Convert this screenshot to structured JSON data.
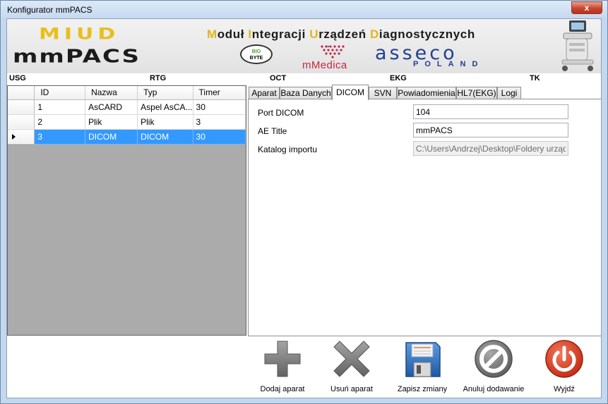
{
  "window": {
    "title": "Konfigurator mmPACS",
    "close_glyph": "x"
  },
  "banner": {
    "logo_top": "MIUD",
    "logo_bottom": "mmPACS",
    "headline": [
      {
        "t": "M",
        "hl": true
      },
      {
        "t": "oduł ",
        "hl": false
      },
      {
        "t": "I",
        "hl": true
      },
      {
        "t": "ntegracji ",
        "hl": false
      },
      {
        "t": "U",
        "hl": true
      },
      {
        "t": "rządzeń ",
        "hl": false
      },
      {
        "t": "D",
        "hl": true
      },
      {
        "t": "iagnostycznych",
        "hl": false
      }
    ],
    "biobyte_bio": "BIO",
    "biobyte_byte": "BYTE",
    "mmedica": "mMedica",
    "asseco": "asseco",
    "poland": "POLAND"
  },
  "modalities": [
    "USG",
    "RTG",
    "OCT",
    "EKG",
    "TK"
  ],
  "grid": {
    "columns": [
      "ID",
      "Nazwa",
      "Typ",
      "Timer"
    ],
    "rows": [
      {
        "id": "1",
        "nazwa": "AsCARD",
        "typ": "Aspel AsCA...",
        "timer": "30",
        "selected": false
      },
      {
        "id": "2",
        "nazwa": "Plik",
        "typ": "Plik",
        "timer": "3",
        "selected": false
      },
      {
        "id": "3",
        "nazwa": "DICOM",
        "typ": "DICOM",
        "timer": "30",
        "selected": true
      }
    ]
  },
  "tabs": [
    "Aparat",
    "Baza Danych",
    "DICOM",
    "SVN",
    "Powiadomienia",
    "HL7(EKG)",
    "Logi"
  ],
  "active_tab": "DICOM",
  "form": {
    "port_label": "Port DICOM",
    "port_value": "104",
    "ae_label": "AE Title",
    "ae_value": "mmPACS",
    "katalog_label": "Katalog importu",
    "katalog_value": "C:\\Users\\Andrzej\\Desktop\\Foldery urządzeń\\"
  },
  "buttons": {
    "add": "Dodaj aparat",
    "remove": "Usuń aparat",
    "save": "Zapisz zmiany",
    "cancel": "Anuluj dodawanie",
    "exit": "Wyjdź"
  },
  "colors": {
    "accent_gold": "#e3b51e",
    "selection": "#3399ff",
    "asseco_blue": "#23408f",
    "mmedica_red": "#c8263f",
    "exit_red": "#d23a1e",
    "icon_gray": "#7a7a7a",
    "save_blue": "#2f6fb5"
  }
}
